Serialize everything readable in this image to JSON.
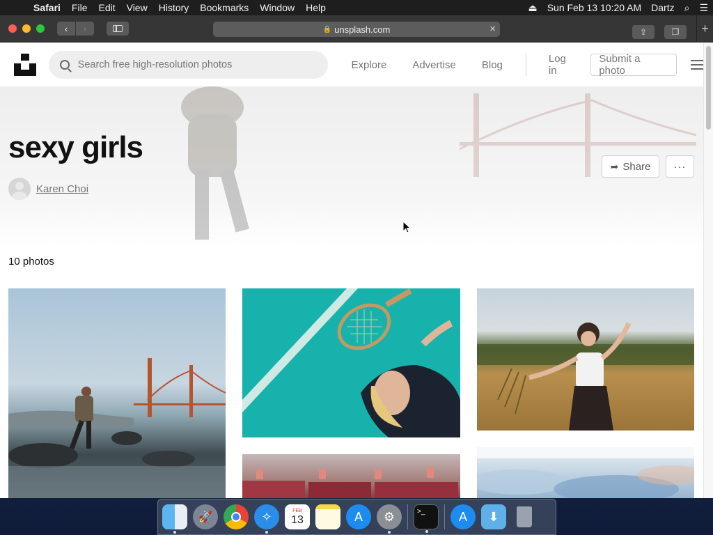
{
  "menubar": {
    "app": "Safari",
    "items": [
      "File",
      "Edit",
      "View",
      "History",
      "Bookmarks",
      "Window",
      "Help"
    ],
    "datetime": "Sun Feb 13  10:20 AM",
    "user": "Dartz"
  },
  "browser": {
    "url": "unsplash.com"
  },
  "header": {
    "search_placeholder": "Search free high-resolution photos",
    "nav": [
      "Explore",
      "Advertise",
      "Blog"
    ],
    "login": "Log in",
    "submit": "Submit a photo"
  },
  "collection": {
    "title": "sexy girls",
    "author": "Karen Choi",
    "share": "Share",
    "more": "···",
    "count": "10 photos"
  },
  "dock": {
    "apps": [
      "finder-icon",
      "launchpad-icon",
      "chrome-icon",
      "safari-icon",
      "calendar-icon",
      "notes-icon",
      "app-store-icon",
      "system-preferences-icon",
      "terminal-icon",
      "app-store-folder-icon",
      "downloads-folder-icon",
      "trash-icon"
    ],
    "calendar_month": "FEB",
    "calendar_day": "13"
  },
  "colors": {
    "accent": "#111111",
    "muted_text": "#767676",
    "border": "#d1d1d1"
  }
}
